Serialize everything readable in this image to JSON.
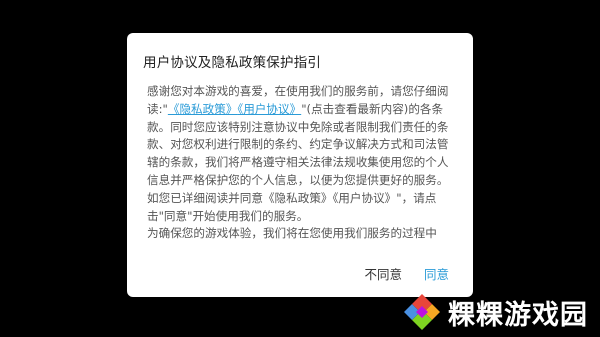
{
  "dialog": {
    "title": "用户协议及隐私政策保护指引",
    "body": {
      "part1": "感谢您对本游戏的喜爱，在使用我们的服务前，请您仔细阅读:\"",
      "privacy_link": "《隐私政策》",
      "terms_link": "《用户协议》",
      "part2": "\"(点击查看最新内容)的各条款。同时您应该特别注意协议中免除或者限制我们责任的条款、对您权利进行限制的条约、约定争议解决方式和司法管辖的条款，我们将严格遵守相关法律法规收集使用您的个人信息并严格保护您的个人信息，以便为您提供更好的服务。如您已详细阅读并同意《隐私政策》《用户协议》\"，请点击\"同意\"开始使用我们的服务。",
      "paragraph2": "为确保您的游戏体验，我们将在您使用我们服务的过程中"
    },
    "disagree_label": "不同意",
    "agree_label": "同意"
  },
  "watermark": {
    "text": "粿粿游戏园",
    "colors": [
      "#e8463a",
      "#f5a623",
      "#7ed321",
      "#4a90e2",
      "#bd10e0"
    ]
  }
}
